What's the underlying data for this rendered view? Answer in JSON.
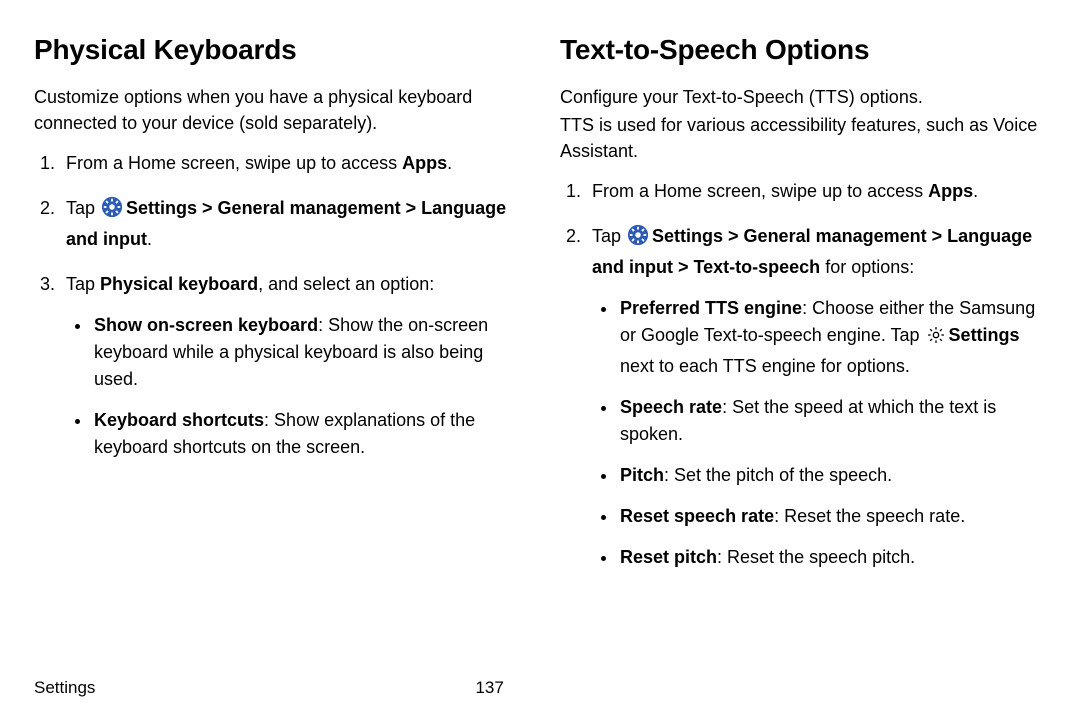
{
  "left": {
    "heading": "Physical Keyboards",
    "intro": "Customize options when you have a physical keyboard connected to your device (sold separately).",
    "steps": {
      "s1_a": "From a Home screen, swipe up to access ",
      "s1_b": "Apps",
      "s1_c": ".",
      "s2_a": "Tap ",
      "s2_b": "Settings > General management > Language and input",
      "s2_c": ".",
      "s3_a": "Tap ",
      "s3_b": "Physical keyboard",
      "s3_c": ", and select an option:"
    },
    "bullets": {
      "b1_a": "Show on-screen keyboard",
      "b1_b": ": Show the on-screen keyboard while a physical keyboard is also being used.",
      "b2_a": "Keyboard shortcuts",
      "b2_b": ": Show explanations of the keyboard shortcuts on the screen."
    }
  },
  "right": {
    "heading": "Text-to-Speech Options",
    "intro1": "Configure your Text-to-Speech (TTS) options.",
    "intro2": "TTS is used for various accessibility features, such as Voice Assistant.",
    "steps": {
      "s1_a": "From a Home screen, swipe up to access ",
      "s1_b": "Apps",
      "s1_c": ".",
      "s2_a": "Tap ",
      "s2_b": "Settings > General management > Language and input > Text-to-speech",
      "s2_c": " for options:"
    },
    "bullets": {
      "b1_a": "Preferred TTS engine",
      "b1_b": ": Choose either the Samsung or Google Text-to-speech engine. Tap ",
      "b1_c": "Settings",
      "b1_d": " next to each TTS engine for options.",
      "b2_a": "Speech rate",
      "b2_b": ": Set the speed at which the text is spoken.",
      "b3_a": "Pitch",
      "b3_b": ": Set the pitch of the speech.",
      "b4_a": "Reset speech rate",
      "b4_b": ": Reset the speech rate.",
      "b5_a": "Reset pitch",
      "b5_b": ": Reset the speech pitch."
    }
  },
  "footer": {
    "section": "Settings",
    "page": "137"
  },
  "icons": {
    "settings_filled": "settings-filled-icon",
    "settings_outline": "settings-outline-icon"
  }
}
